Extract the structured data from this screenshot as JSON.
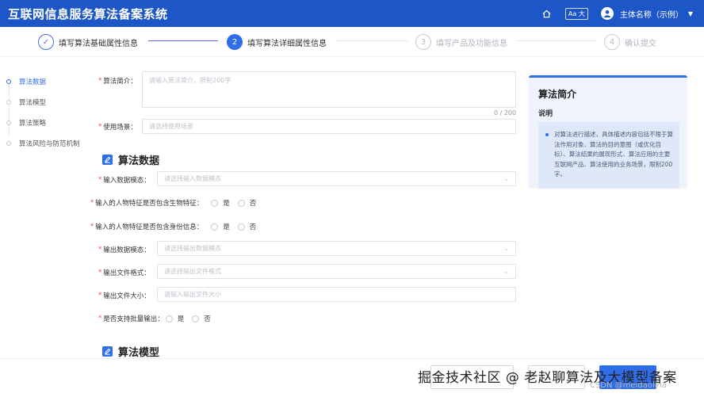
{
  "header": {
    "title": "互联网信息服务算法备案系统",
    "font_button": "Aa 大",
    "user_name": "主体名称（示例）"
  },
  "steps": [
    {
      "num": "✓",
      "label": "填写算法基础属性信息",
      "state": "done"
    },
    {
      "num": "2",
      "label": "填写算法详细属性信息",
      "state": "active"
    },
    {
      "num": "3",
      "label": "填写产品及功能信息",
      "state": "pending"
    },
    {
      "num": "4",
      "label": "确认提交",
      "state": "pending"
    }
  ],
  "sidebar": {
    "items": [
      {
        "label": "算法数据",
        "active": true
      },
      {
        "label": "算法模型",
        "active": false
      },
      {
        "label": "算法策略",
        "active": false
      },
      {
        "label": "算法风险与防范机制",
        "active": false
      }
    ]
  },
  "form": {
    "intro_label": "算法简介：",
    "intro_placeholder": "请输入算法简介，限制200字",
    "intro_counter": "0 / 200",
    "scene_label": "使用场景：",
    "scene_placeholder": "请选择使用场景",
    "section_data": "算法数据",
    "input_mode_label": "输入数据模态：",
    "input_mode_placeholder": "请选择输入数据模态",
    "bio_label": "输入的人物特征是否包含生物特征：",
    "id_label": "输入的人物特征是否包含身份信息：",
    "yes": "是",
    "no": "否",
    "output_mode_label": "输出数据模态：",
    "output_mode_placeholder": "请选择输出数据模态",
    "output_format_label": "输出文件格式：",
    "output_format_placeholder": "请选择输出文件格式",
    "output_size_label": "输出文件大小：",
    "output_size_placeholder": "请输入输出文件大小",
    "batch_label": "是否支持批量输出：",
    "section_model": "算法模型"
  },
  "help": {
    "title": "算法简介",
    "subtitle": "说明",
    "body": "对算法进行描述，具体描述内容包括不限于算法作用对象、算法的目的意图（或优化目标）、算法结果的展现形式、算法应用的主要互联网产品、算法使用的业务场景，限制200字。"
  },
  "watermark": {
    "main": "掘金技术社区 @ 老赵聊算法及大模型备案",
    "sub": "CSDN @meidaolina"
  },
  "colors": {
    "header_bg": "#1c56c7",
    "accent": "#2f6ee8",
    "required": "#e34d4d"
  }
}
